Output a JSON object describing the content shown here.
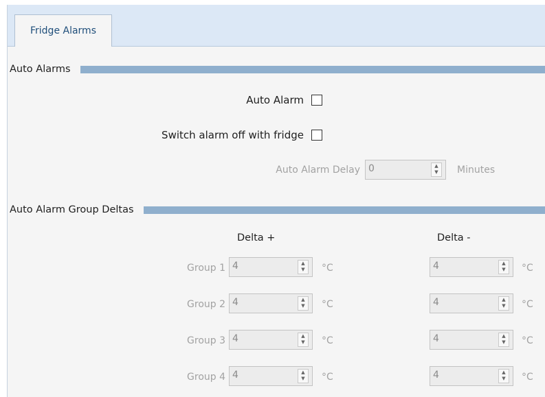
{
  "tab": {
    "label": "Fridge Alarms"
  },
  "auto_alarms": {
    "title": "Auto Alarms",
    "auto_alarm_label": "Auto Alarm",
    "auto_alarm_checked": false,
    "switch_off_label": "Switch alarm off with fridge",
    "switch_off_checked": false,
    "delay_label": "Auto Alarm Delay",
    "delay_value": "0",
    "delay_unit": "Minutes"
  },
  "group_deltas": {
    "title": "Auto Alarm Group Deltas",
    "delta_plus_label": "Delta +",
    "delta_minus_label": "Delta -",
    "unit": "°C",
    "groups": [
      {
        "label": "Group 1",
        "plus": "4",
        "minus": "4"
      },
      {
        "label": "Group 2",
        "plus": "4",
        "minus": "4"
      },
      {
        "label": "Group 3",
        "plus": "4",
        "minus": "4"
      },
      {
        "label": "Group 4",
        "plus": "4",
        "minus": "4"
      }
    ]
  }
}
